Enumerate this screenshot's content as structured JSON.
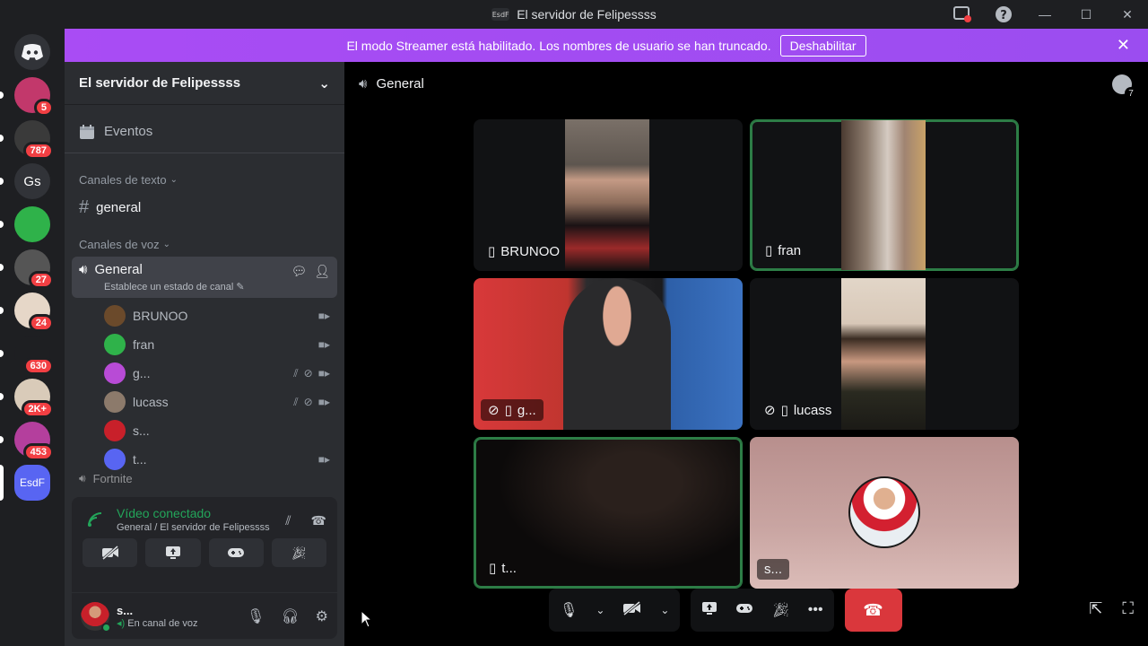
{
  "window": {
    "title": "El servidor de Felipessss",
    "icon_text": "EsdF"
  },
  "banner": {
    "message": "El modo Streamer está habilitado. Los nombres de usuario se han truncado.",
    "button": "Deshabilitar"
  },
  "servers": [
    {
      "badge": "5",
      "color": "#c2386b"
    },
    {
      "badge": "787",
      "color": "#3a3a3a"
    },
    {
      "label": "Gs",
      "color": "#313338"
    },
    {
      "badge": "",
      "color": "#2fb24a"
    },
    {
      "badge": "27",
      "color": "#555"
    },
    {
      "badge": "24",
      "color": "#e6d7c8"
    },
    {
      "badge": "630",
      "color": "#1e1f22"
    },
    {
      "badge": "2K+",
      "color": "#d9cbb9"
    },
    {
      "badge": "453",
      "color": "#b43f9d"
    },
    {
      "label": "EsdF",
      "color": "#5865f2"
    }
  ],
  "sidebar": {
    "server_name": "El servidor de Felipessss",
    "events_label": "Eventos",
    "text_category": "Canales de texto",
    "text_channel": "general",
    "voice_category": "Canales de voz",
    "voice_channel": "General",
    "voice_status": "Establece un estado de canal",
    "voice_users": [
      {
        "name": "BRUNOO",
        "av": "#6b4a2b"
      },
      {
        "name": "fran",
        "av": "#2fb24a"
      },
      {
        "name": "g...",
        "av": "#b84bd6"
      },
      {
        "name": "lucass",
        "av": "#8c7a6b"
      },
      {
        "name": "s...",
        "av": "#c8202a"
      },
      {
        "name": "t...",
        "av": "#5865f2"
      }
    ],
    "more_channel": "Fortnite"
  },
  "voice_panel": {
    "status": "Vídeo conectado",
    "location": "General / El servidor de Felipessss"
  },
  "user": {
    "name": "s...",
    "status": "En canal de voz"
  },
  "stage": {
    "channel": "General",
    "activity_count": "7",
    "tiles": [
      {
        "label": "BRUNOO"
      },
      {
        "label": "fran"
      },
      {
        "label": "g..."
      },
      {
        "label": "lucass"
      },
      {
        "label": "t..."
      },
      {
        "label": "s..."
      }
    ]
  },
  "colors": {
    "accent_green": "#23a55a",
    "hangup": "#da373c",
    "banner": "#a14cf0",
    "discord": "#5865f2"
  }
}
